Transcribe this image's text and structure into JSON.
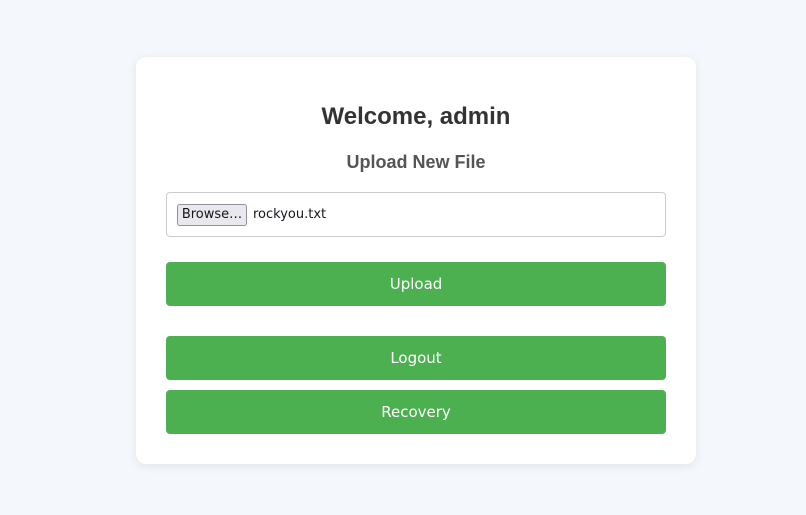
{
  "page": {
    "welcome_title": "Welcome, admin",
    "upload_heading": "Upload New File"
  },
  "file_input": {
    "browse_label": "Browse…",
    "selected_file": "rockyou.txt"
  },
  "buttons": {
    "upload_label": "Upload",
    "logout_label": "Logout",
    "recovery_label": "Recovery"
  },
  "colors": {
    "accent_green": "#4caf50",
    "background": "#f4f7fb",
    "card": "#ffffff"
  }
}
